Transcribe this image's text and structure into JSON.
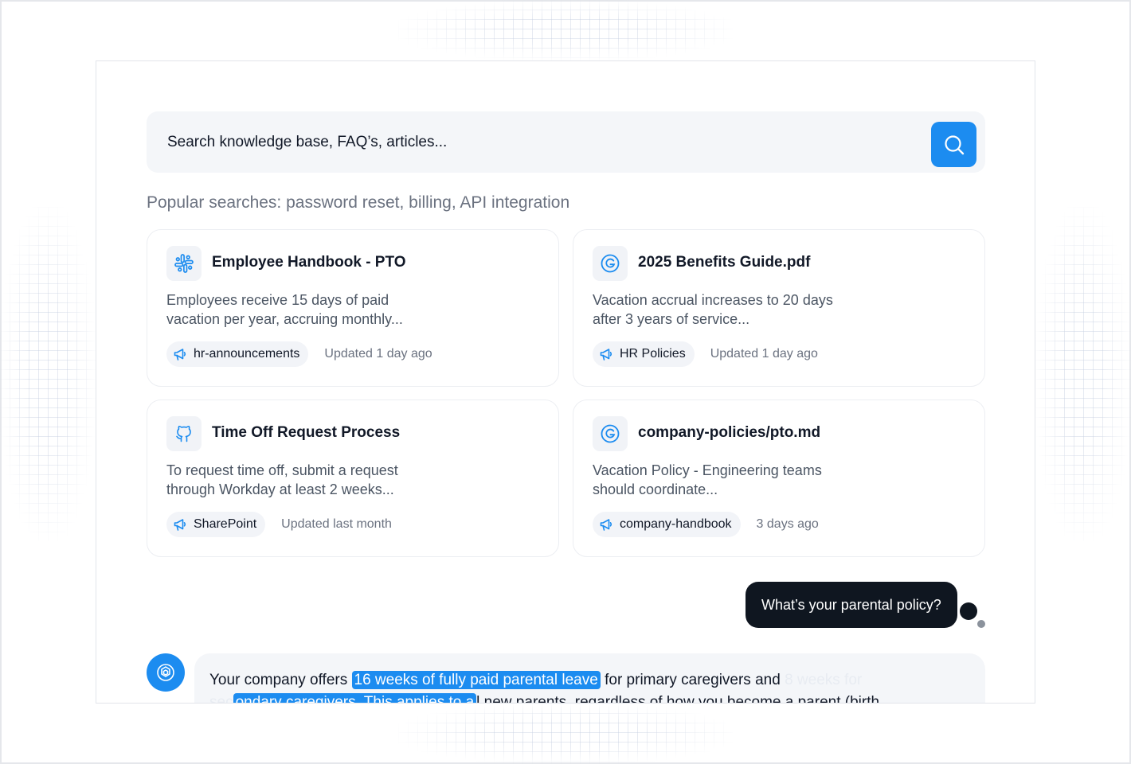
{
  "search": {
    "placeholder": "Search knowledge base, FAQ’s, articles..."
  },
  "popular": "Popular searches: password reset, billing, API integration",
  "cards": [
    {
      "icon": "slack-icon",
      "title": "Employee Handbook - PTO",
      "snippet_line1": "Employees receive 15 days of paid",
      "snippet_line2": "vacation per year, accruing monthly...",
      "chip_icon": "megaphone-icon",
      "chip": "hr-announcements",
      "updated": "Updated 1 day ago"
    },
    {
      "icon": "google-icon",
      "title": "2025 Benefits Guide.pdf",
      "snippet_line1": "Vacation accrual increases to 20 days",
      "snippet_line2": "after 3 years of service...",
      "chip_icon": "megaphone-icon",
      "chip": "HR Policies",
      "updated": "Updated 1 day ago"
    },
    {
      "icon": "github-icon",
      "title": "Time Off Request Process",
      "snippet_line1": "To request time off, submit a request",
      "snippet_line2": "through Workday at least 2 weeks...",
      "chip_icon": "megaphone-icon",
      "chip": "SharePoint",
      "updated": "Updated last month"
    },
    {
      "icon": "google-icon",
      "title": "company-policies/pto.md",
      "snippet_line1": "Vacation Policy - Engineering teams",
      "snippet_line2": "should coordinate...",
      "chip_icon": "megaphone-icon",
      "chip": "company-handbook",
      "updated": "3 days ago"
    }
  ],
  "chat": {
    "user_message": "What’s your parental policy?",
    "bot_icon": "ai-assistant-icon",
    "answer": {
      "part1": "Your company offers",
      "highlight1": "16 weeks of fully paid parental leave",
      "part2": "for primary caregivers and",
      "faded1": "8 weeks for",
      "faded2": "sec",
      "highlight2": "ondary caregivers. This applies to a",
      "part3": "l new parents, regardless of how you become a parent (birth,"
    }
  },
  "colors": {
    "accent": "#1c8cf0",
    "dark_bubble": "#0f1620",
    "surface": "#f4f6f9"
  }
}
